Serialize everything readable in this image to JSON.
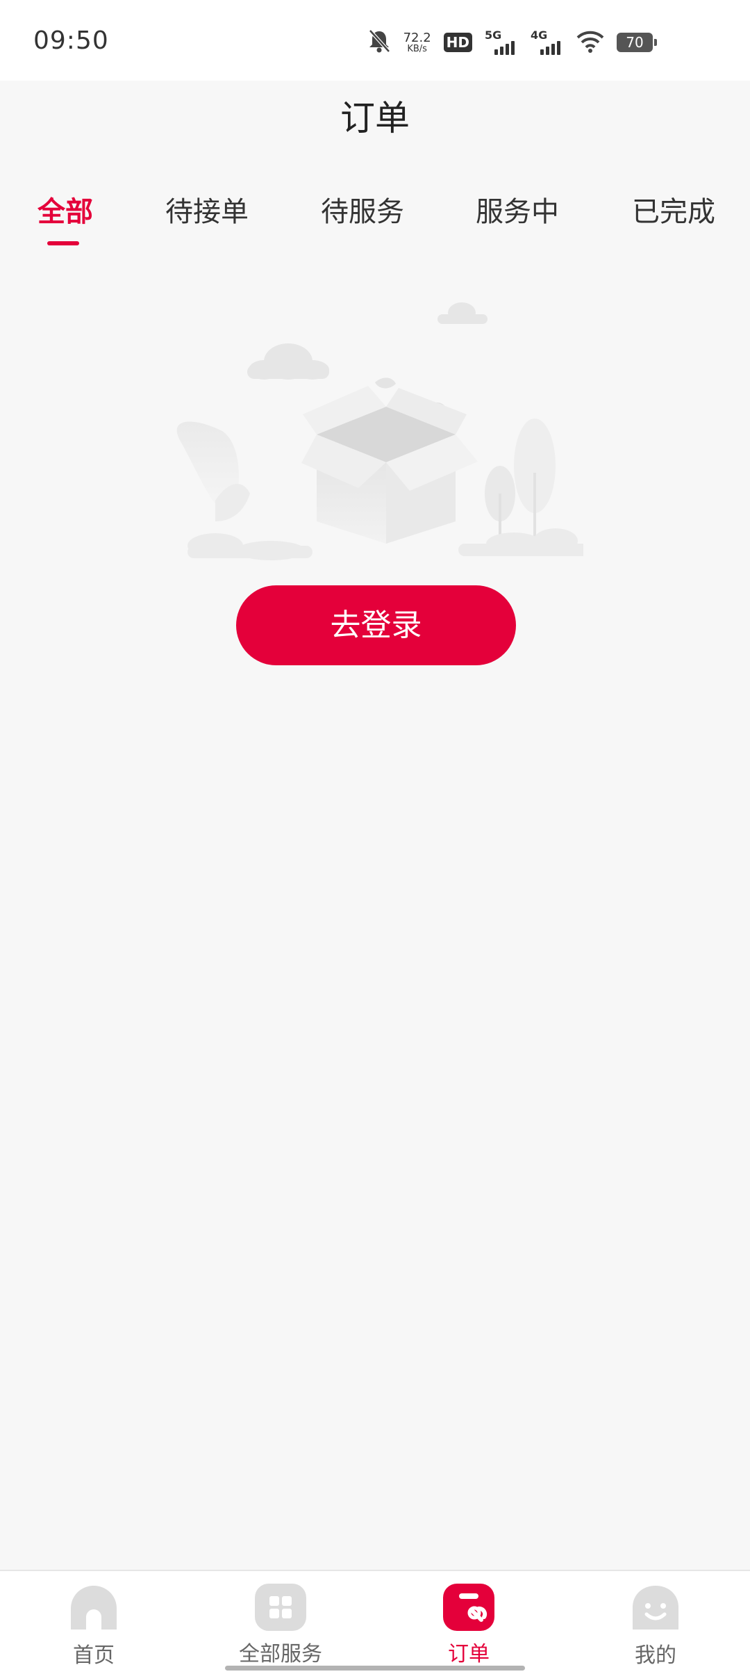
{
  "status_bar": {
    "time": "09:50",
    "net_speed_value": "72.2",
    "net_speed_unit": "KB/s",
    "hd_badge": "HD",
    "signal_5g": "5G",
    "signal_4g": "4G",
    "battery": "70",
    "icons": [
      "mute-bell-icon",
      "hd-icon",
      "signal-5g-icon",
      "signal-4g-icon",
      "wifi-icon",
      "battery-icon"
    ]
  },
  "page": {
    "title": "订单"
  },
  "tabs": [
    {
      "label": "全部",
      "active": true
    },
    {
      "label": "待接单",
      "active": false
    },
    {
      "label": "待服务",
      "active": false
    },
    {
      "label": "服务中",
      "active": false
    },
    {
      "label": "已完成",
      "active": false
    }
  ],
  "empty_state": {
    "illustration": "empty-box-illustration",
    "button_label": "去登录"
  },
  "bottom_nav": [
    {
      "label": "首页",
      "icon": "home-icon",
      "active": false
    },
    {
      "label": "全部服务",
      "icon": "grid-icon",
      "active": false
    },
    {
      "label": "订单",
      "icon": "order-wrench-icon",
      "active": true
    },
    {
      "label": "我的",
      "icon": "profile-face-icon",
      "active": false
    }
  ],
  "colors": {
    "accent": "#e4003a",
    "background": "#f7f7f7",
    "nav_inactive": "#dcdcdc"
  }
}
